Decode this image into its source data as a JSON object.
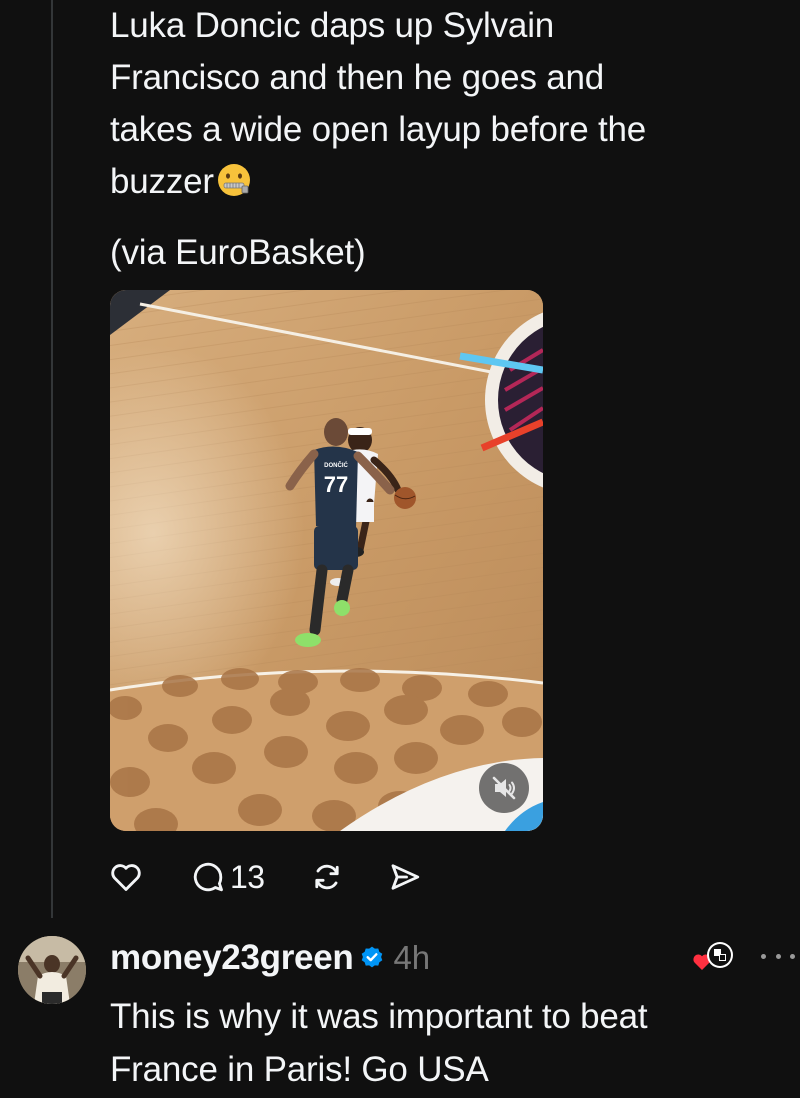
{
  "post": {
    "text_line1": "Luka Doncic daps up Sylvain",
    "text_line2": "Francisco and then he goes and",
    "text_line3": "takes a wide open layup before the",
    "text_line4": "buzzer",
    "emoji": "zipper-mouth-face",
    "source": "(via EuroBasket)",
    "media": {
      "type": "video",
      "jersey_name": "DONČIĆ",
      "jersey_number": "77",
      "muted": true
    },
    "actions": {
      "like_icon": "heart-icon",
      "reply_icon": "comment-icon",
      "reply_count": "13",
      "repost_icon": "repost-icon",
      "share_icon": "send-icon"
    }
  },
  "reply": {
    "username": "money23green",
    "verified": true,
    "timestamp": "4h",
    "text_line1": "This is why it was important to beat",
    "text_line2": "France in Paris! Go USA",
    "liked_by_author": true
  },
  "colors": {
    "background": "#101010",
    "text": "#f3f5f7",
    "muted_text": "#777777",
    "verified_blue": "#0095f6",
    "thread_line": "#333638",
    "heart_red": "#ff3040"
  }
}
